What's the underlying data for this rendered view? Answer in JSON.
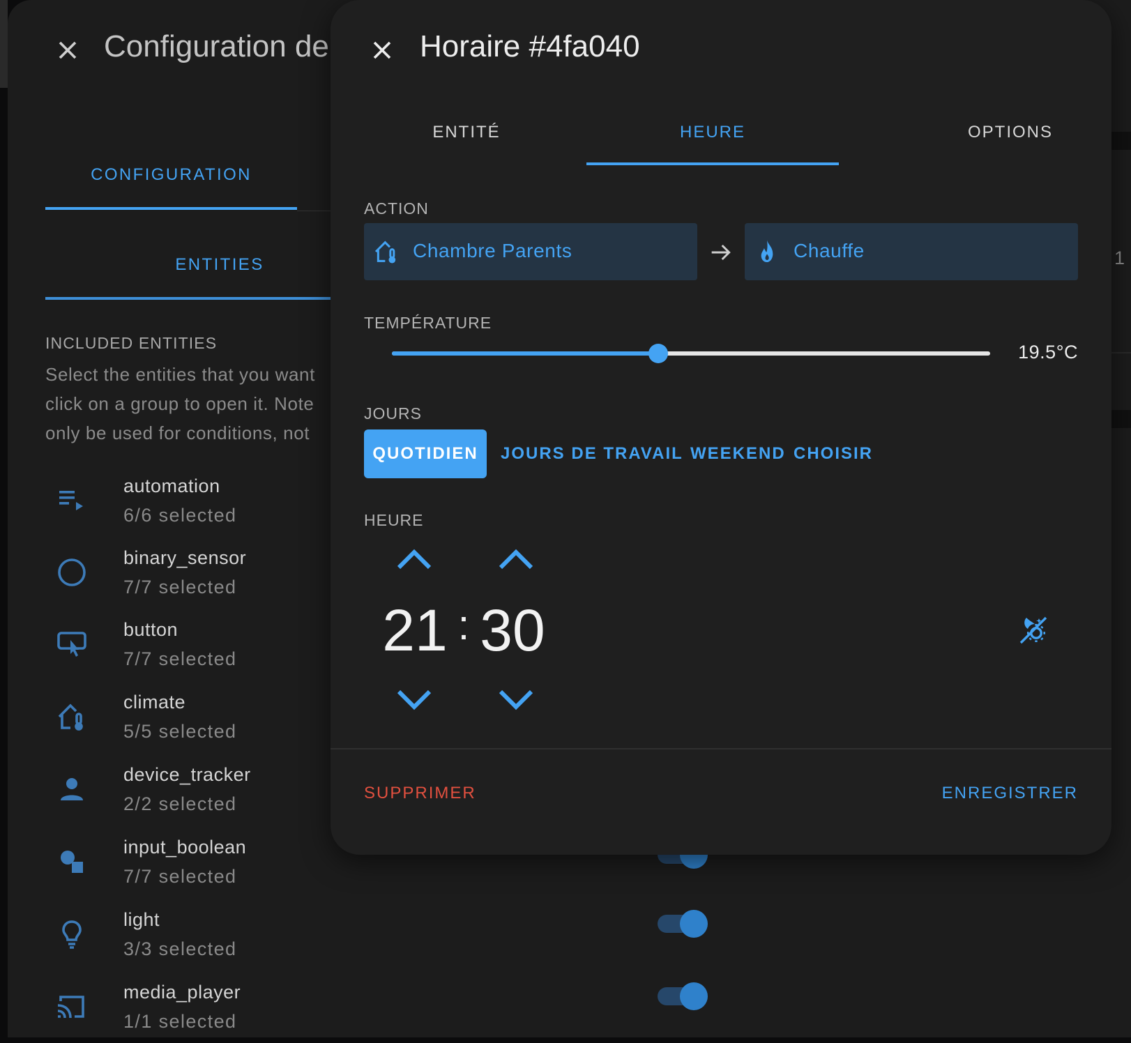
{
  "background_dialog": {
    "title": "Configuration de",
    "tabs": [
      "CONFIGURATION",
      "ENTITIES"
    ],
    "included_entities": {
      "title": "INCLUDED ENTITIES",
      "description_lines": [
        "Select the entities that you want",
        "click on a group to open it. Note",
        "only be used for conditions, not"
      ]
    },
    "entity_groups": [
      {
        "name": "automation",
        "count": "6/6 selected",
        "icon": "playlist-play-icon"
      },
      {
        "name": "binary_sensor",
        "count": "7/7 selected",
        "icon": "circle-outline-icon"
      },
      {
        "name": "button",
        "count": "7/7 selected",
        "icon": "button-pointer-icon"
      },
      {
        "name": "climate",
        "count": "5/5 selected",
        "icon": "home-thermometer-icon"
      },
      {
        "name": "device_tracker",
        "count": "2/2 selected",
        "icon": "account-icon"
      },
      {
        "name": "input_boolean",
        "count": "7/7 selected",
        "icon": "shapes-icon"
      },
      {
        "name": "light",
        "count": "3/3 selected",
        "icon": "lightbulb-outline-icon"
      },
      {
        "name": "media_player",
        "count": "1/1 selected",
        "icon": "cast-icon"
      }
    ],
    "toggles_on": [
      true,
      true,
      true
    ],
    "right_edge_text": "1"
  },
  "schedule_dialog": {
    "title": "Horaire #4fa040",
    "tabs": {
      "entity": "ENTITÉ",
      "hour": "HEURE",
      "options": "OPTIONS",
      "active": "hour"
    },
    "action": {
      "label": "ACTION",
      "entity": "Chambre Parents",
      "entity_icon": "home-thermometer-icon",
      "arrow_icon": "arrow-right-icon",
      "service": "Chauffe",
      "service_icon": "fire-icon"
    },
    "temperature": {
      "label": "TEMPÉRATURE",
      "value_text": "19.5°C",
      "slider_fraction": 0.445
    },
    "days": {
      "label": "JOURS",
      "options": [
        "QUOTIDIEN",
        "JOURS DE TRAVAIL",
        "WEEKEND",
        "CHOISIR"
      ],
      "selected": "QUOTIDIEN"
    },
    "time": {
      "label": "HEURE",
      "hours": "21",
      "separator": ":",
      "minutes": "30",
      "sun_toggle_icon": "theme-light-dark-icon"
    },
    "footer": {
      "delete_label": "SUPPRIMER",
      "save_label": "ENREGISTRER"
    }
  },
  "colors": {
    "accent": "#44a3f3",
    "danger": "#e2503f",
    "chip_background": "#243444",
    "dialog_background": "#1f1f1f"
  }
}
